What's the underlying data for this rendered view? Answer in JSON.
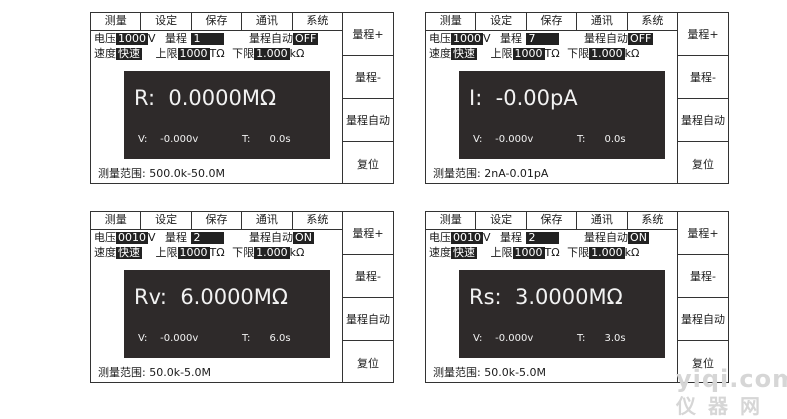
{
  "tabs": [
    "测量",
    "设定",
    "保存",
    "通讯",
    "系统"
  ],
  "side_buttons": [
    "量程+",
    "量程-",
    "量程自动",
    "复位"
  ],
  "labels": {
    "voltage": "电压",
    "volt_unit": "V",
    "range": "量程",
    "auto_range": "量程自动",
    "speed": "速度",
    "upper": "上限",
    "upper_unit": "TΩ",
    "lower": "下限",
    "lower_unit": "kΩ",
    "v_label": "V:",
    "t_label": "T:",
    "range_label": "测量范围:"
  },
  "panels": [
    {
      "voltage": "1000",
      "range": "1",
      "auto": "OFF",
      "speed": "快速",
      "upper": "1000",
      "lower": "1.000",
      "mode": "R:",
      "reading": "0.0000MΩ",
      "v": "-0.000v",
      "t": "0.0s",
      "meas_range": "500.0k-50.0M"
    },
    {
      "voltage": "1000",
      "range": "7",
      "auto": "OFF",
      "speed": "快速",
      "upper": "1000",
      "lower": "1.000",
      "mode": "I:",
      "reading": "-0.00pA",
      "v": "-0.000v",
      "t": "0.0s",
      "meas_range": "2nA-0.01pA"
    },
    {
      "voltage": "0010",
      "range": "2",
      "auto": "ON",
      "speed": "快速",
      "upper": "1000",
      "lower": "1.000",
      "mode": "Rv:",
      "reading": "6.0000MΩ",
      "v": "-0.000v",
      "t": "6.0s",
      "meas_range": "50.0k-5.0M"
    },
    {
      "voltage": "0010",
      "range": "2",
      "auto": "ON",
      "speed": "快速",
      "upper": "1000",
      "lower": "1.000",
      "mode": "Rs:",
      "reading": "3.0000MΩ",
      "v": "-0.000v",
      "t": "3.0s",
      "meas_range": "50.0k-5.0M"
    }
  ],
  "watermark": {
    "line1": "yiqi.com",
    "line2": "仪器网"
  }
}
